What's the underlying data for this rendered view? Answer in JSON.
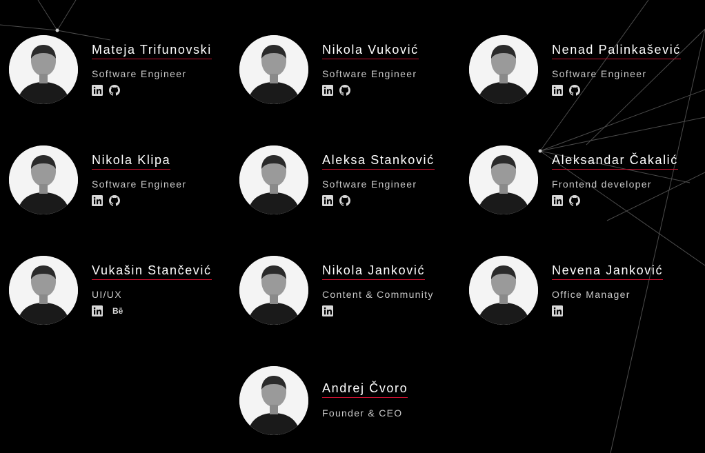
{
  "accent_color": "#c8102e",
  "background_color": "#000000",
  "team": [
    {
      "name": "Mateja Trifunovski",
      "role": "Software Engineer",
      "icons": [
        "linkedin-icon",
        "github-icon"
      ]
    },
    {
      "name": "Nikola Vuković",
      "role": "Software Engineer",
      "icons": [
        "linkedin-icon",
        "github-icon"
      ]
    },
    {
      "name": "Nenad Palinkašević",
      "role": "Software Engineer",
      "icons": [
        "linkedin-icon",
        "github-icon"
      ]
    },
    {
      "name": "Nikola Klipa",
      "role": "Software Engineer",
      "icons": [
        "linkedin-icon",
        "github-icon"
      ]
    },
    {
      "name": "Aleksa Stanković",
      "role": "Software Engineer",
      "icons": [
        "linkedin-icon",
        "github-icon"
      ]
    },
    {
      "name": "Aleksandar Čakalić",
      "role": "Frontend developer",
      "icons": [
        "linkedin-icon",
        "github-icon"
      ]
    },
    {
      "name": "Vukašin Stančević",
      "role": "UI/UX",
      "icons": [
        "linkedin-icon",
        "behance-icon"
      ]
    },
    {
      "name": "Nikola Janković",
      "role": "Content & Community",
      "icons": [
        "linkedin-icon"
      ]
    },
    {
      "name": "Nevena Janković",
      "role": "Office Manager",
      "icons": [
        "linkedin-icon"
      ]
    },
    {
      "name": "Andrej Čvoro",
      "role": "Founder & CEO",
      "icons": []
    }
  ],
  "behance_label": "Bē"
}
